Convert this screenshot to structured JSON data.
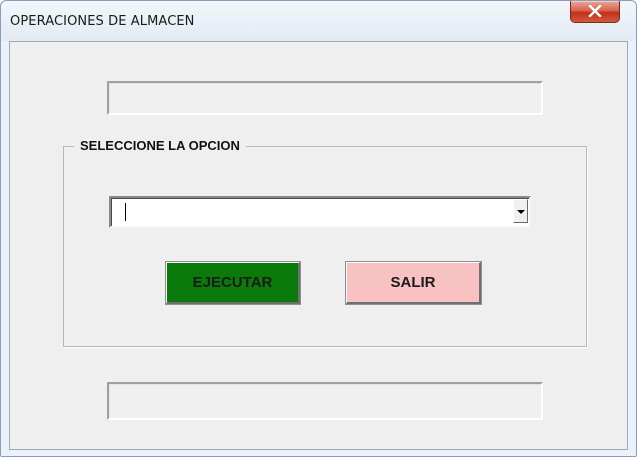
{
  "window": {
    "title": "OPERACIONES DE ALMACEN",
    "close_icon": "close-icon"
  },
  "form": {
    "top_field_value": "",
    "group_label": "SELECCIONE LA OPCION",
    "option_combo_value": "",
    "execute_label": "EJECUTAR",
    "exit_label": "SALIR",
    "bottom_field_value": ""
  },
  "colors": {
    "execute_button": "#0a7a0a",
    "exit_button": "#f9c2c2",
    "close_button": "#c4301a"
  }
}
